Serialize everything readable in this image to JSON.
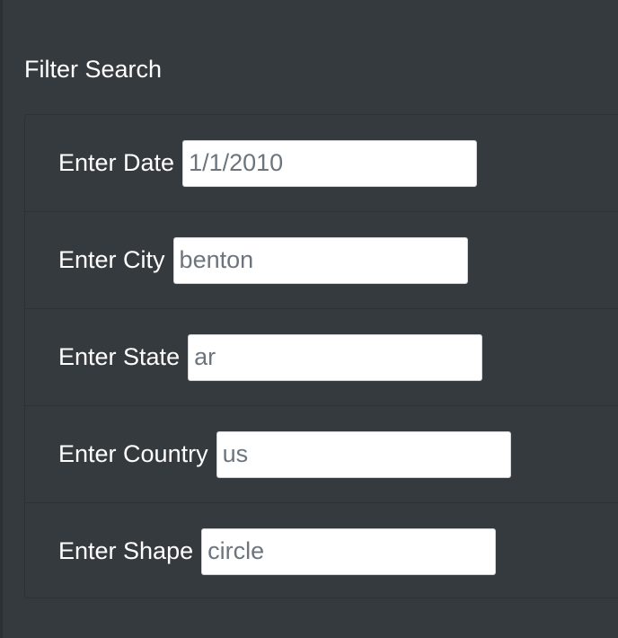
{
  "panel": {
    "title": "Filter Search"
  },
  "filters": [
    {
      "label": "Enter Date",
      "value": "1/1/2010"
    },
    {
      "label": "Enter City",
      "value": "benton"
    },
    {
      "label": "Enter State",
      "value": "ar"
    },
    {
      "label": "Enter Country",
      "value": "us"
    },
    {
      "label": "Enter Shape",
      "value": "circle"
    }
  ],
  "colors": {
    "background": "#353a3f",
    "text": "#ffffff",
    "input_background": "#ffffff",
    "input_text": "#6c757d"
  }
}
